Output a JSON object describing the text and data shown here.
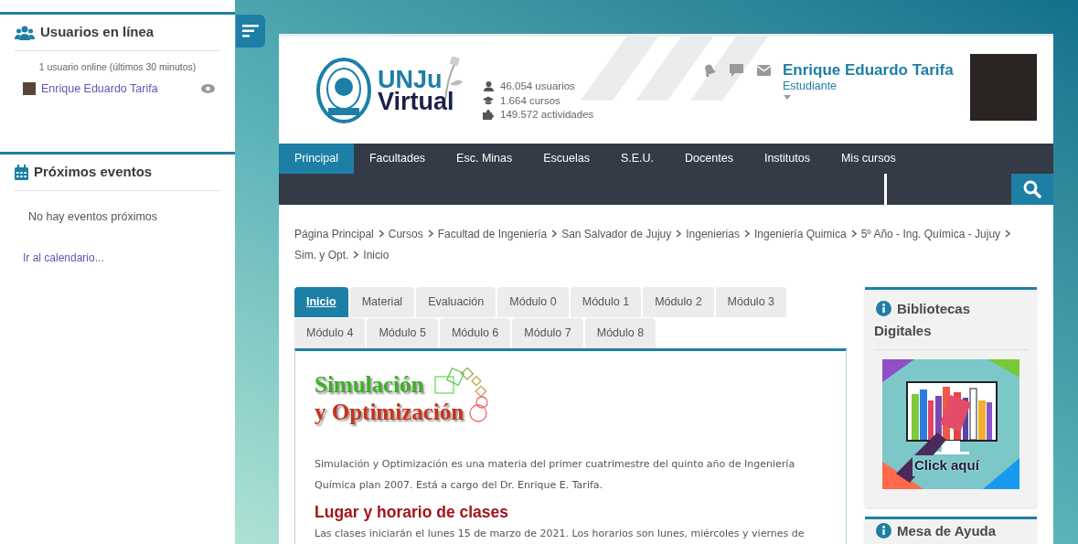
{
  "sidebar_blocks": [
    {
      "kind": "online_users",
      "title": "Usuarios en línea",
      "summary": "1 usuario online (últimos 30 minutos)",
      "users": [
        {
          "name": "Enrique Eduardo Tarifa"
        }
      ]
    },
    {
      "kind": "events",
      "title": "Próximos eventos",
      "message": "No hay eventos próximos",
      "link": "Ir al calendario..."
    }
  ],
  "header": {
    "logo": [
      "UNJu",
      "Virtual"
    ],
    "stats": [
      {
        "kind": "users",
        "text": "46.054 usuarios"
      },
      {
        "kind": "courses",
        "text": "1.664 cursos"
      },
      {
        "kind": "activities",
        "text": "149.572 actividades"
      }
    ],
    "user": {
      "name": "Enrique Eduardo Tarifa",
      "role": "Estudiante"
    }
  },
  "nav": [
    {
      "label": "Principal",
      "selected": true
    },
    {
      "label": "Facultades",
      "selected": false
    },
    {
      "label": "Esc. Minas",
      "selected": false
    },
    {
      "label": "Escuelas",
      "selected": false
    },
    {
      "label": "S.E.U.",
      "selected": false
    },
    {
      "label": "Docentes",
      "selected": false
    },
    {
      "label": "Institutos",
      "selected": false
    },
    {
      "label": "Mis cursos",
      "selected": false
    }
  ],
  "breadcrumb": [
    "Página Principal",
    "Cursos",
    "Facultad de Ingeniería",
    "San Salvador de Jujuy",
    "Ingenierias",
    "Ingeniería Quimica",
    "5º Año - Ing. Química - Jujuy",
    "Sim. y Opt.",
    "Inicio"
  ],
  "tabs": [
    {
      "label": "Inicio",
      "selected": true
    },
    {
      "label": "Material",
      "selected": false
    },
    {
      "label": "Evaluación",
      "selected": false
    },
    {
      "label": "Módulo 0",
      "selected": false
    },
    {
      "label": "Módulo 1",
      "selected": false
    },
    {
      "label": "Módulo 2",
      "selected": false
    },
    {
      "label": "Módulo 3",
      "selected": false
    },
    {
      "label": "Módulo 4",
      "selected": false
    },
    {
      "label": "Módulo 5",
      "selected": false
    },
    {
      "label": "Módulo 6",
      "selected": false
    },
    {
      "label": "Módulo 7",
      "selected": false
    },
    {
      "label": "Módulo 8",
      "selected": false
    }
  ],
  "content": {
    "banner": [
      "Simulación",
      "y Optimización"
    ],
    "intro": "Simulación y Optimización es una materia del primer cuatrimestre del quinto año de Ingeniería Química plan 2007. Está a cargo del Dr. Enrique E. Tarifa.",
    "heading": "Lugar y horario de clases",
    "schedule": "Las clases iniciarán el lunes 15 de marzo de 2021. Los horarios son lunes, miércoles y viernes de"
  },
  "side_blocks": [
    {
      "title": "Bibliotecas Digitales",
      "image_caption": "Click aquí"
    },
    {
      "title": "Mesa de Ayuda"
    }
  ]
}
